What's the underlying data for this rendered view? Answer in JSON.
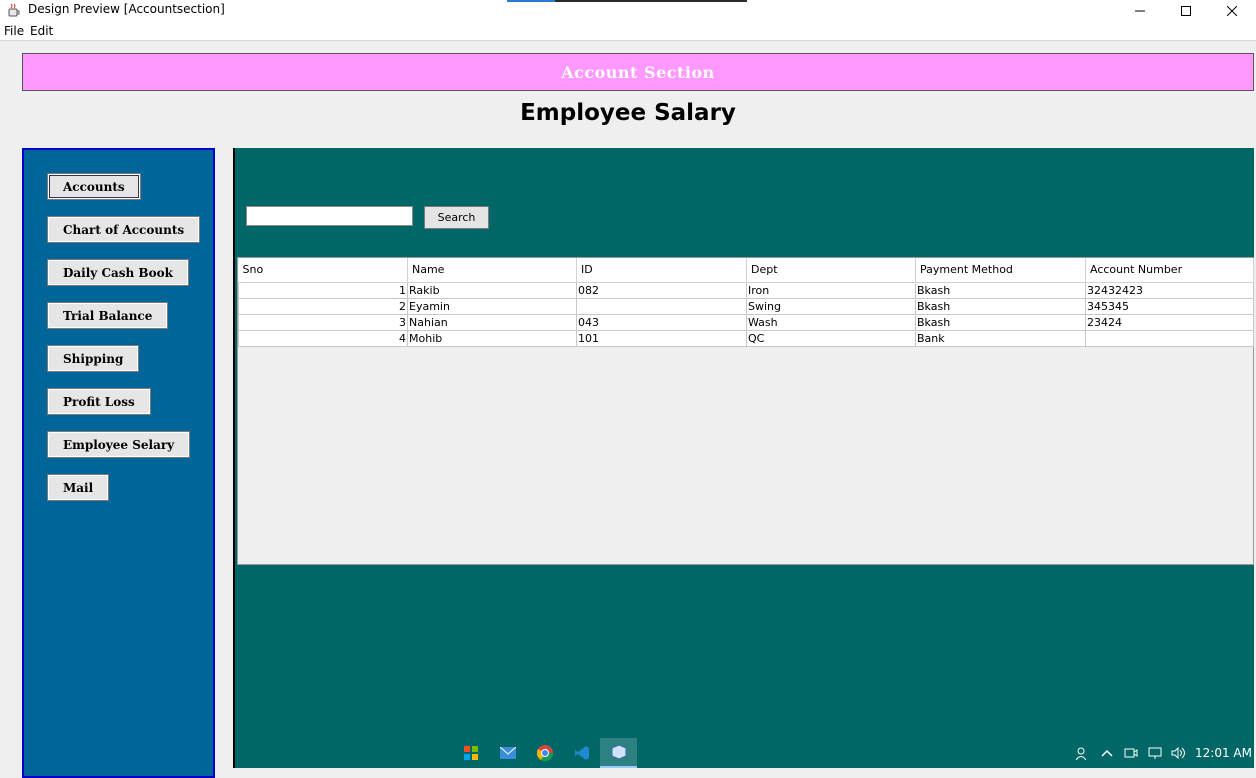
{
  "window": {
    "title": "Design Preview [Accountsection]",
    "progress_fraction": 0.2,
    "controls": [
      "minimize-icon",
      "maximize-icon",
      "close-icon"
    ]
  },
  "menu": [
    "File",
    "Edit"
  ],
  "banner": {
    "text": "Account Section",
    "color": "#ff99ff"
  },
  "page_title": "Employee Salary",
  "sidebar": {
    "color": "#006699",
    "items": [
      {
        "label": "Accounts"
      },
      {
        "label": "Chart of Accounts"
      },
      {
        "label": "Daily Cash Book"
      },
      {
        "label": "Trial Balance"
      },
      {
        "label": "Shipping"
      },
      {
        "label": "Profit Loss"
      },
      {
        "label": "Employee Selary"
      },
      {
        "label": "Mail"
      }
    ]
  },
  "main": {
    "color": "#006666",
    "search": {
      "value": "",
      "button_label": "Search"
    },
    "table": {
      "headers": [
        "Sno",
        "Name",
        "ID",
        "Dept",
        "Payment Method",
        "Account Number"
      ],
      "rows": [
        [
          "1",
          "Rakib",
          "082",
          "Iron",
          "Bkash",
          "32432423"
        ],
        [
          "2",
          "Eyamin",
          "",
          "Swing",
          "Bkash",
          "345345"
        ],
        [
          "3",
          "Nahian",
          "043",
          "Wash",
          "Bkash",
          "23424"
        ],
        [
          "4",
          "Mohib",
          "101",
          "QC",
          "Bank",
          ""
        ]
      ]
    }
  },
  "taskbar": {
    "apps": [
      "start-icon",
      "mail-icon",
      "chrome-icon",
      "vscode-icon",
      "java-app-icon"
    ],
    "tray": [
      "people-icon",
      "chevron-up-icon",
      "meet-icon",
      "network-icon",
      "volume-icon"
    ],
    "clock": "12:01 AM"
  }
}
